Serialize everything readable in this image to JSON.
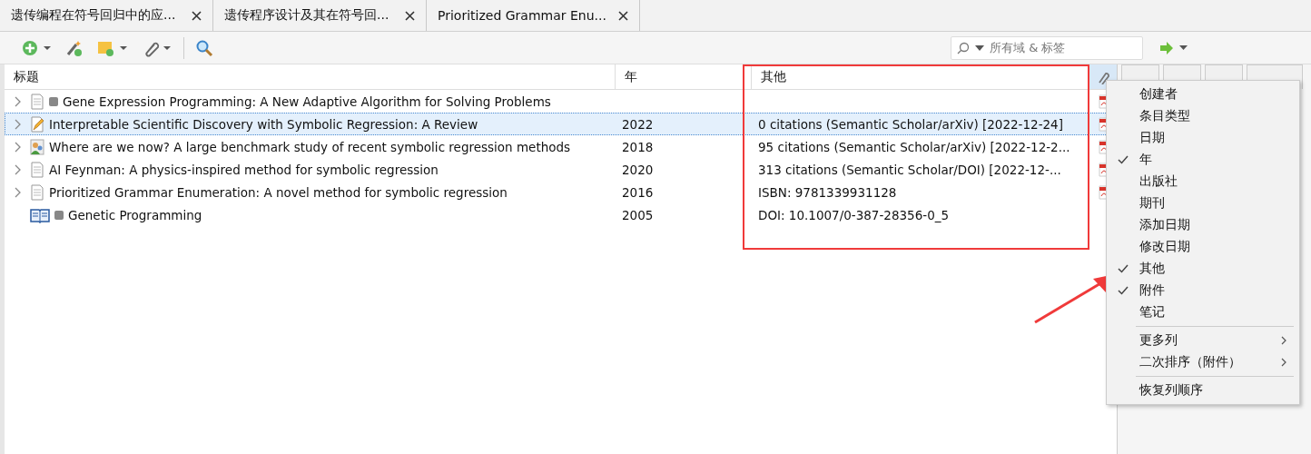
{
  "tabs": [
    {
      "label": "遗传编程在符号回归中的应...",
      "selected": false
    },
    {
      "label": "遗传程序设计及其在符号回...",
      "selected": false
    },
    {
      "label": "Prioritized Grammar Enu...",
      "selected": false
    }
  ],
  "search": {
    "placeholder": "所有域 & 标签"
  },
  "table": {
    "columns": [
      "标题",
      "年",
      "其他"
    ],
    "rows": [
      {
        "kind": "document",
        "expandable": true,
        "marker": true,
        "title": "Gene Expression Programming: A New Adaptive Algorithm for Solving Problems",
        "year": "",
        "other": "",
        "attachment": true,
        "selected": false
      },
      {
        "kind": "note",
        "expandable": true,
        "marker": false,
        "title": "Interpretable Scientific Discovery with Symbolic Regression: A Review",
        "year": "2022",
        "other": "0 citations (Semantic Scholar/arXiv) [2022-12-24]",
        "attachment": true,
        "selected": true
      },
      {
        "kind": "presentation",
        "expandable": true,
        "marker": false,
        "title": "Where are we now? A large benchmark study of recent symbolic regression methods",
        "year": "2018",
        "other": "95 citations (Semantic Scholar/arXiv) [2022-12-2...",
        "attachment": true,
        "selected": false
      },
      {
        "kind": "document",
        "expandable": true,
        "marker": false,
        "title": "AI Feynman: A physics-inspired method for symbolic regression",
        "year": "2020",
        "other": "313 citations (Semantic Scholar/DOI) [2022-12-...",
        "attachment": true,
        "selected": false
      },
      {
        "kind": "document",
        "expandable": true,
        "marker": false,
        "title": "Prioritized Grammar Enumeration: A novel method for symbolic regression",
        "year": "2016",
        "other": "ISBN: 9781339931128",
        "attachment": true,
        "selected": false
      },
      {
        "kind": "book",
        "expandable": false,
        "marker": true,
        "title": "Genetic Programming",
        "year": "2005",
        "other": "DOI: 10.1007/0-387-28356-0_5",
        "attachment": false,
        "selected": false
      }
    ]
  },
  "context_menu": {
    "items": [
      {
        "kind": "option",
        "label": "创建者",
        "checked": false
      },
      {
        "kind": "option",
        "label": "条目类型",
        "checked": false
      },
      {
        "kind": "option",
        "label": "日期",
        "checked": false
      },
      {
        "kind": "option",
        "label": "年",
        "checked": true
      },
      {
        "kind": "option",
        "label": "出版社",
        "checked": false
      },
      {
        "kind": "option",
        "label": "期刊",
        "checked": false
      },
      {
        "kind": "option",
        "label": "添加日期",
        "checked": false
      },
      {
        "kind": "option",
        "label": "修改日期",
        "checked": false
      },
      {
        "kind": "option",
        "label": "其他",
        "checked": true
      },
      {
        "kind": "option",
        "label": "附件",
        "checked": true
      },
      {
        "kind": "option",
        "label": "笔记",
        "checked": false
      },
      {
        "kind": "separator"
      },
      {
        "kind": "submenu",
        "label": "更多列"
      },
      {
        "kind": "submenu",
        "label": "二次排序（附件）"
      },
      {
        "kind": "separator"
      },
      {
        "kind": "action",
        "label": "恢复列顺序"
      }
    ]
  }
}
